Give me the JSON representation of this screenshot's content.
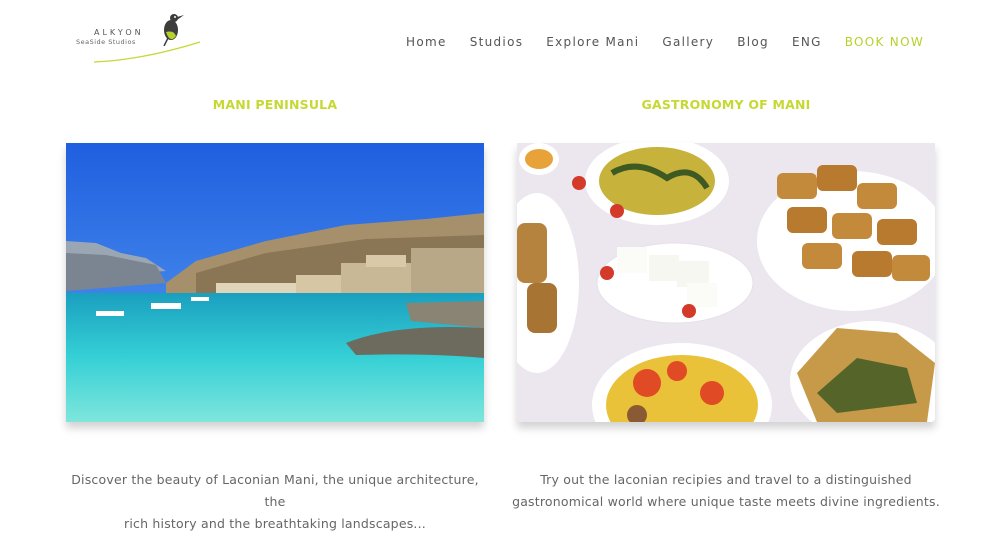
{
  "brand": {
    "name": "ALKYON",
    "tagline": "SeaSide Studios"
  },
  "nav": {
    "items": [
      "Home",
      "Studios",
      "Explore Mani",
      "Gallery",
      "Blog",
      "ENG"
    ],
    "cta": "BOOK NOW"
  },
  "colors": {
    "accent": "#c6d832",
    "text": "#666666"
  },
  "cards": [
    {
      "title": "MANI PENINSULA",
      "image": "coastal-village-photo",
      "description_line1": "Discover the beauty of Laconian Mani, the unique architecture, the",
      "description_line2": "rich history and the breathtaking landscapes..."
    },
    {
      "title": "GASTRONOMY OF MANI",
      "image": "greek-food-spread-photo",
      "description_line1": "Try out the laconian recipies and travel to a distinguished",
      "description_line2": "gastronomical world where unique taste meets divine ingredients."
    }
  ]
}
